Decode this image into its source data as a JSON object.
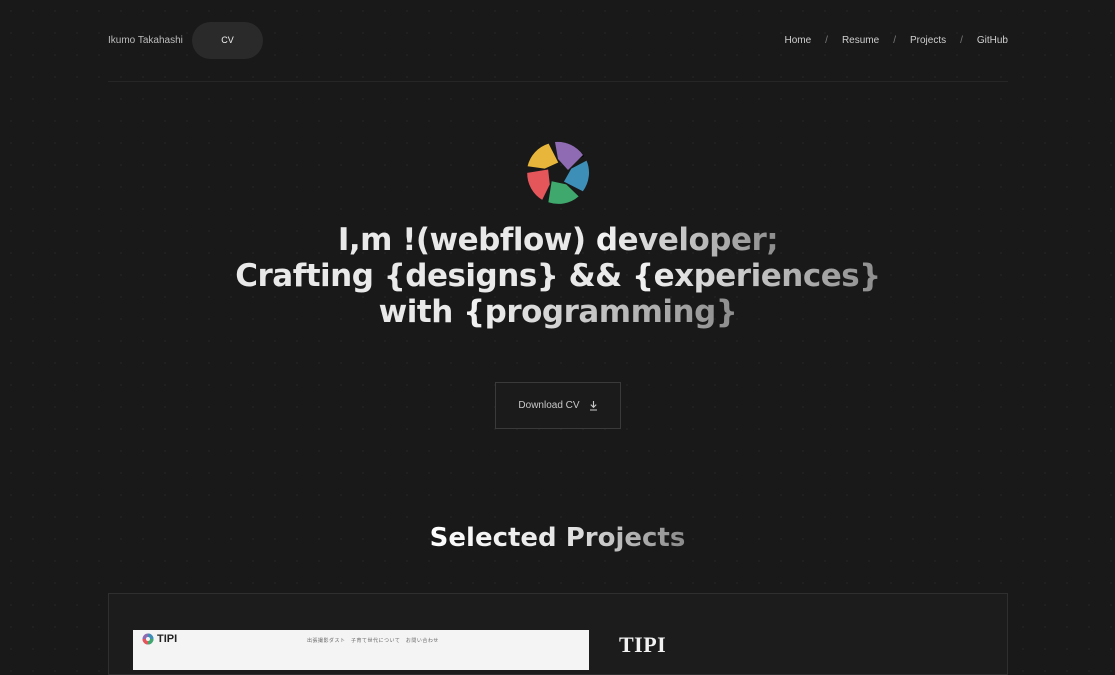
{
  "header": {
    "brand": "Ikumo Takahashi",
    "cv_label": "CV",
    "nav": [
      {
        "label": "Home"
      },
      {
        "label": "Resume"
      },
      {
        "label": "Projects"
      },
      {
        "label": "GitHub"
      }
    ],
    "nav_separator": "/"
  },
  "hero": {
    "line1_plain": "I,m !(webflow) ",
    "line1_grad": "developer;",
    "line2_plain": "Crafting {designs} && ",
    "line2_grad": "{experiences}",
    "line3_plain": "with ",
    "line3_grad": "{programming}"
  },
  "download_button": {
    "label": "Download CV",
    "icon": "download-icon"
  },
  "projects_section": {
    "title": "Selected Projects"
  },
  "project_card": {
    "title": "TIPI",
    "screenshot_logo": "TIPI",
    "screenshot_nav": "出張撮影ダスト　子育て世代について　お問い合わせ"
  },
  "colors": {
    "background": "#191919",
    "logo_purple": "#8e6bb3",
    "logo_blue": "#3d8fb8",
    "logo_green": "#3fa86d",
    "logo_red": "#e5565b",
    "logo_yellow": "#e8b63a"
  }
}
